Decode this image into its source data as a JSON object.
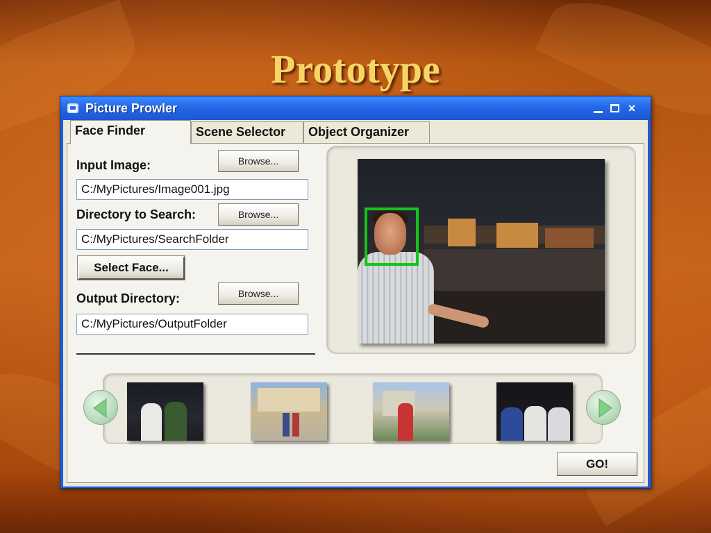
{
  "slide": {
    "title": "Prototype"
  },
  "window": {
    "title": "Picture Prowler",
    "controls": {
      "minimize": "_",
      "maximize": "□",
      "close": "×"
    }
  },
  "tabs": [
    {
      "label": "Face Finder",
      "active": true
    },
    {
      "label": "Scene Selector",
      "active": false
    },
    {
      "label": "Object Organizer",
      "active": false
    }
  ],
  "form": {
    "input_image_label": "Input Image:",
    "input_image_browse": "Browse...",
    "input_image_value": "C:/MyPictures/Image001.jpg",
    "directory_label": "Directory to Search:",
    "directory_browse": "Browse...",
    "directory_value": "C:/MyPictures/SearchFolder",
    "select_face": "Select Face...",
    "output_label": "Output Directory:",
    "output_browse": "Browse...",
    "output_value": "C:/MyPictures/OutputFolder"
  },
  "actions": {
    "go": "GO!"
  },
  "icons": {
    "window": "window-icon",
    "prev": "arrow-left-icon",
    "next": "arrow-right-icon"
  },
  "colors": {
    "title_gold": "#f7d565",
    "titlebar_blue": "#2468e8",
    "face_box_green": "#15c51a"
  }
}
